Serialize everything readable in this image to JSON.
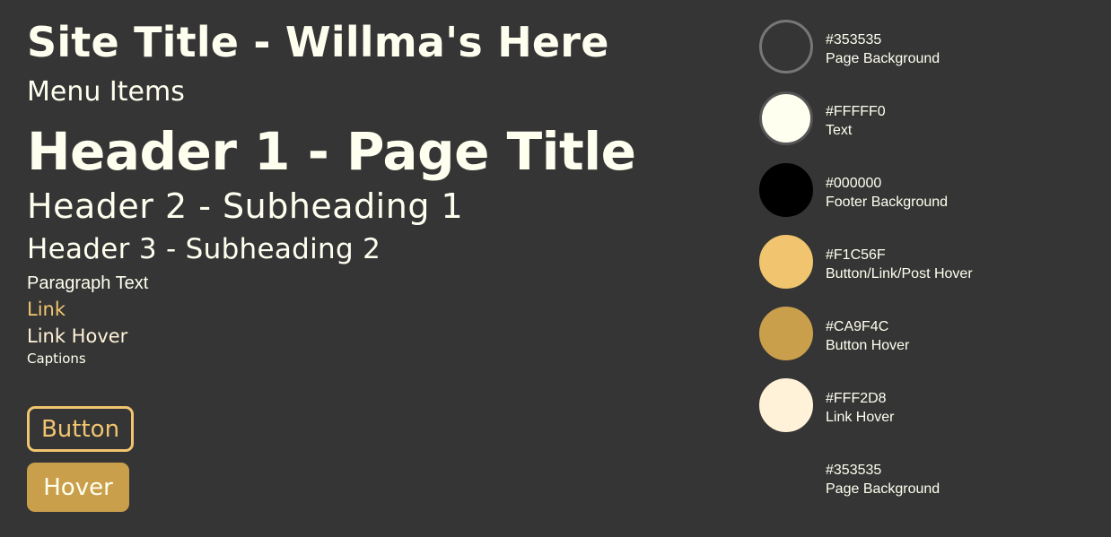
{
  "typography": {
    "site_title": "Site Title - Willma's Here",
    "menu_items": "Menu Items",
    "header_1": "Header 1 - Page Title",
    "header_2": "Header 2 - Subheading 1",
    "header_3": "Header 3 - Subheading 2",
    "paragraph": "Paragraph Text",
    "link": "Link",
    "link_hover": "Link Hover",
    "captions": "Captions"
  },
  "buttons": {
    "outline_label": "Button",
    "hover_label": "Hover"
  },
  "palette": [
    {
      "hex": "#353535",
      "label": "Page Background",
      "swatch": "#353535",
      "border": "#777777"
    },
    {
      "hex": "#FFFFF0",
      "label": "Text",
      "swatch": "#FFFFF0",
      "border": "#555555"
    },
    {
      "hex": "#000000",
      "label": "Footer Background",
      "swatch": "#000000",
      "border": "#000000"
    },
    {
      "hex": "#F1C56F",
      "label": "Button/Link/Post Hover",
      "swatch": "#F1C56F",
      "border": "#F1C56F"
    },
    {
      "hex": "#CA9F4C",
      "label": "Button Hover",
      "swatch": "#CA9F4C",
      "border": "#CA9F4C"
    },
    {
      "hex": "#FFF2D8",
      "label": "Link Hover",
      "swatch": "#FFF2D8",
      "border": "#FFF2D8"
    },
    {
      "hex": "#353535",
      "label": "Page Background",
      "swatch": "#353535",
      "border": "#353535"
    }
  ]
}
